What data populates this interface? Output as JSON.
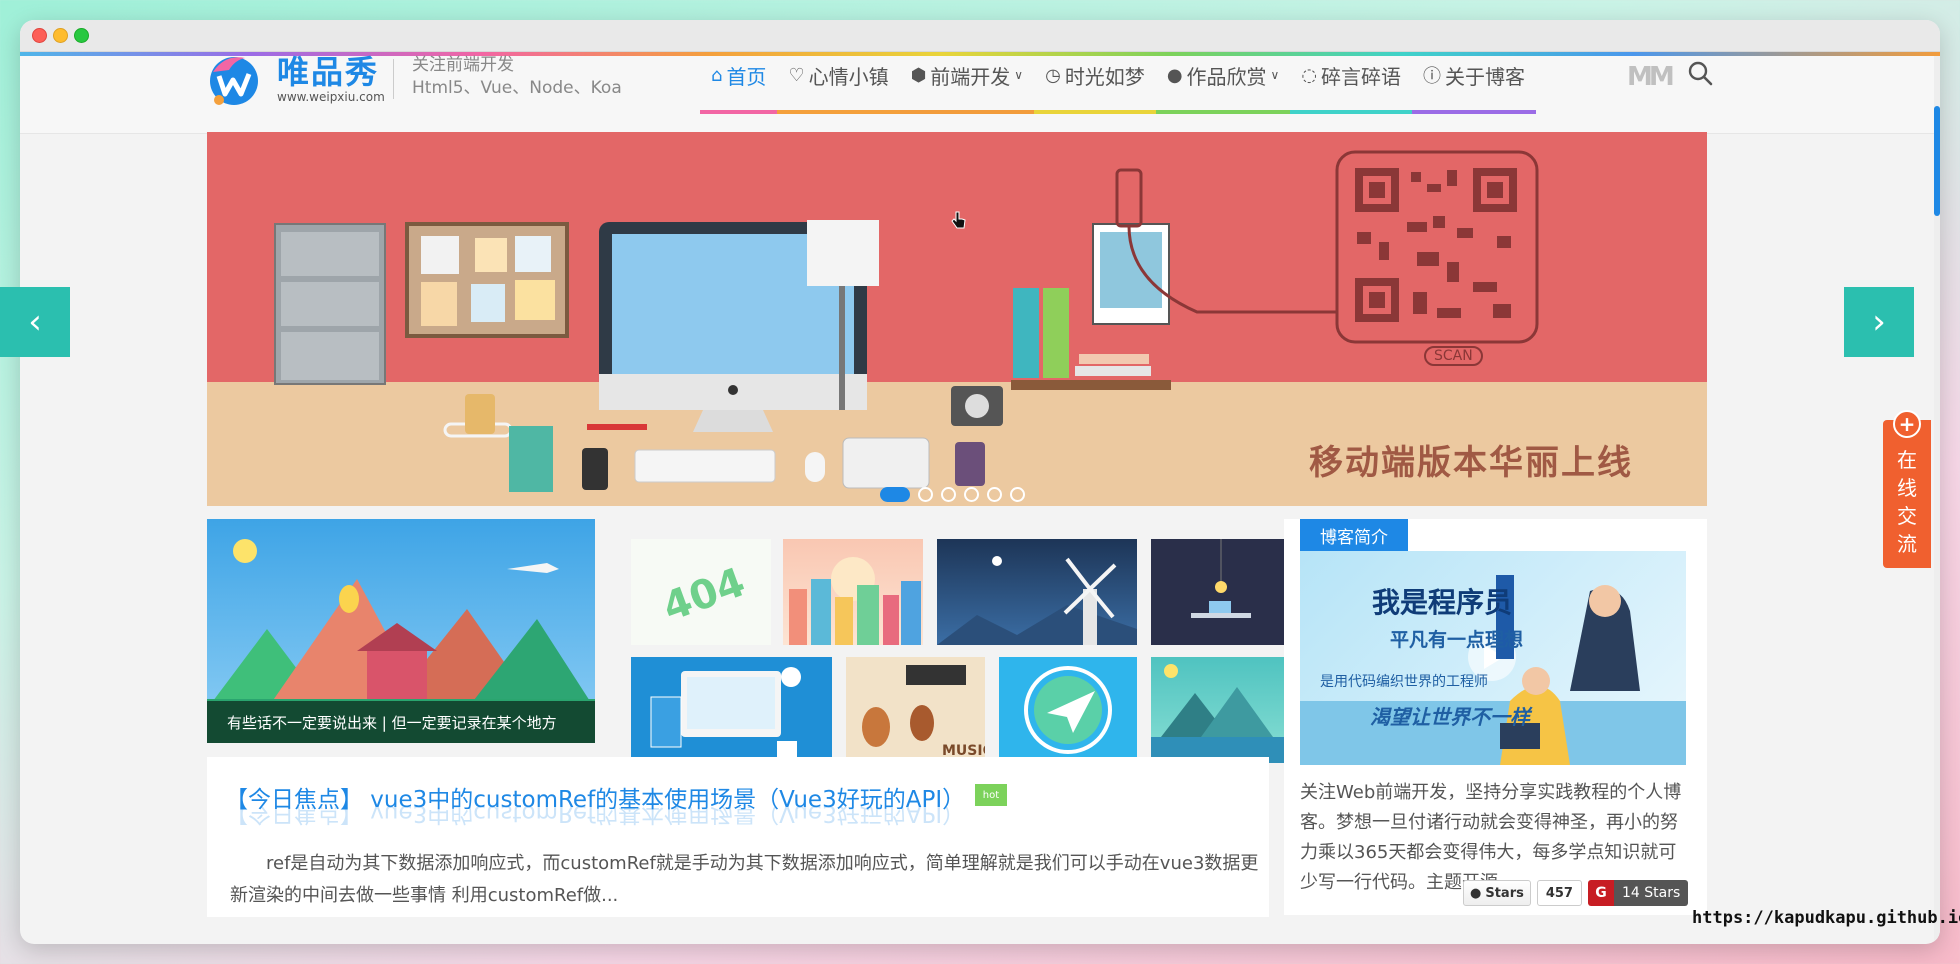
{
  "brand": {
    "logo_name": "唯品秀",
    "logo_url": "www.weipxiu.com",
    "tagline_1": "关注前端开发",
    "tagline_2": "Html5、Vue、Node、Koa"
  },
  "nav": {
    "items": [
      {
        "label": "首页",
        "icon": "home-icon",
        "active": true,
        "color": "#4fb6e9"
      },
      {
        "label": "心情小镇",
        "icon": "heart-icon",
        "active": false,
        "color": "#f4a03c"
      },
      {
        "label": "前端开发",
        "icon": "code-icon",
        "active": false,
        "dropdown": true,
        "color": "#f266a4"
      },
      {
        "label": "时光如梦",
        "icon": "clock-icon",
        "active": false,
        "color": "#e9d43a"
      },
      {
        "label": "作品欣赏",
        "icon": "github-icon",
        "active": false,
        "dropdown": true,
        "color": "#7cd25b"
      },
      {
        "label": "碎言碎语",
        "icon": "chat-bubble-icon",
        "active": false,
        "color": "#3fd2c9"
      },
      {
        "label": "关于博客",
        "icon": "info-icon",
        "active": false,
        "color": "#9b6ce6"
      }
    ],
    "brand_mark": "M"
  },
  "banner": {
    "slogan": "移动端版本华丽上线",
    "scan_label": "SCAN",
    "dots": 6,
    "active_dot": 0
  },
  "featured": {
    "caption": "有些话不一定要说出来 | 但一定要记录在某个地方"
  },
  "focus": {
    "title": "【今日焦点】 vue3中的customRef的基本使用场景（Vue3好玩的API）",
    "badge": "hot",
    "body": "ref是自动为其下数据添加响应式，而customRef就是手动为其下数据添加响应式，简单理解就是我们可以手动在vue3数据更新渲染的中间去做一些事情 利用customRef做..."
  },
  "sidebar": {
    "tab_label": "博客简介",
    "profile_title": "我是程序员",
    "profile_sub": "平凡有一点理想",
    "profile_line3": "是用代码编织世界的工程师",
    "profile_line4": "渴望让世界不一样",
    "description": "关注Web前端开发，坚持分享实践教程的个人博客。梦想一旦付诸行动就会变得神圣，再小的努力乘以365天都会变得伟大，每多学点知识就可少写一行代码。主题开源",
    "github_stars_label": "Stars",
    "github_count": "457",
    "gitee_logo": "G",
    "gitee_stars": "14 Stars"
  },
  "chat_widget": {
    "label": "在线交流"
  },
  "watermark": "https://kapudkapu.github.io",
  "colors": {
    "accent": "#1e88e5",
    "banner_bg": "#e36767",
    "arrow_bg": "#2bbfaf",
    "chat_bg": "#f0602f"
  }
}
